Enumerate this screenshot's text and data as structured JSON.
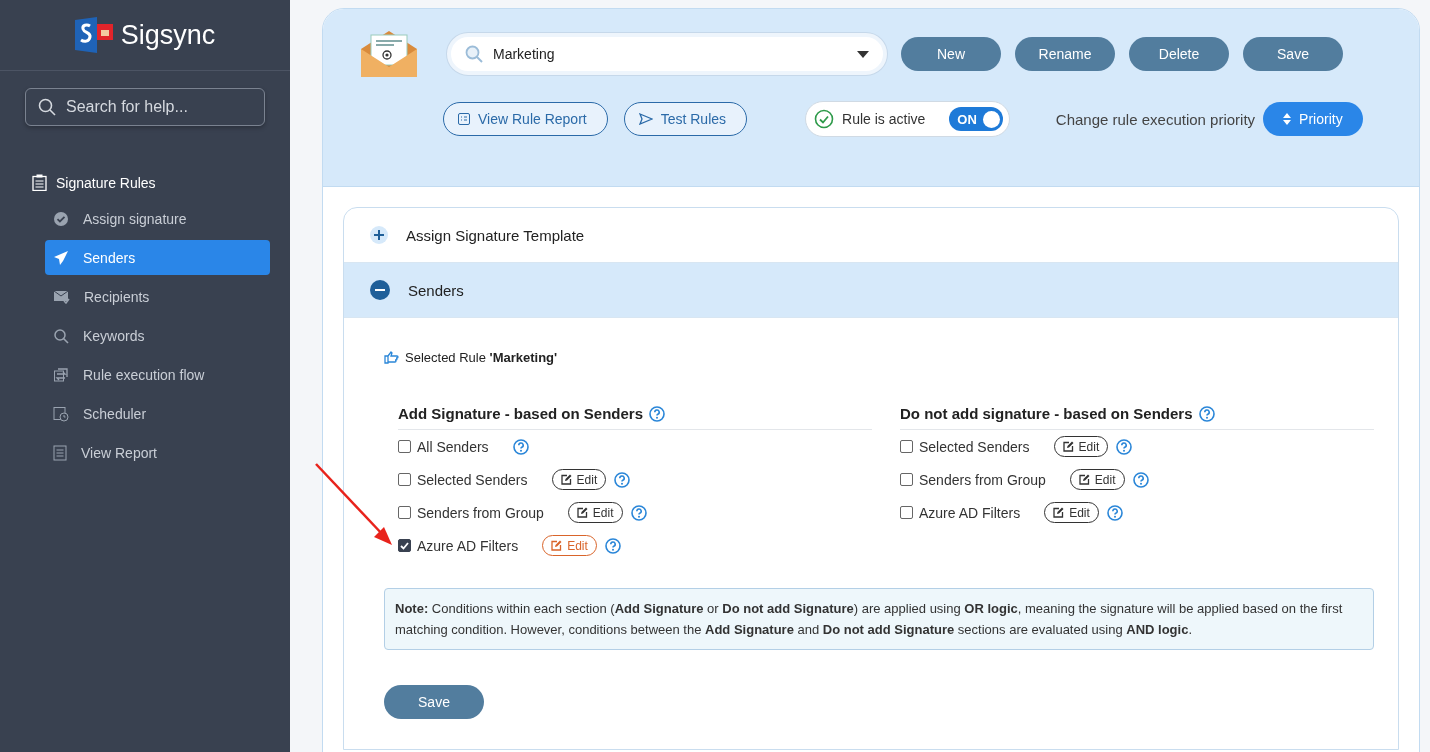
{
  "sidebar": {
    "logo": "Sigsync",
    "search": {
      "placeholder": "Search for help..."
    },
    "section": "Signature Rules",
    "items": [
      {
        "label": "Assign signature",
        "kind": "check",
        "selected": false
      },
      {
        "label": "Senders",
        "kind": "plane",
        "selected": true
      },
      {
        "label": "Recipients",
        "kind": "mail",
        "selected": false
      },
      {
        "label": "Keywords",
        "kind": "search",
        "selected": false
      },
      {
        "label": "Rule execution flow",
        "kind": "flow",
        "selected": false
      },
      {
        "label": "Scheduler",
        "kind": "calendar",
        "selected": false
      },
      {
        "label": "View Report",
        "kind": "report",
        "selected": false
      }
    ]
  },
  "toolbar": {
    "rule_select": {
      "value": "Marketing"
    },
    "buttons": [
      "New",
      "Rename",
      "Delete",
      "Save"
    ],
    "view_report": "View Rule Report",
    "test_rules": "Test Rules",
    "rule_active": {
      "label": "Rule is active",
      "toggle": "ON",
      "on": true
    },
    "priority_label": "Change rule execution priority",
    "priority_button": "Priority"
  },
  "accordion": [
    {
      "title": "Assign Signature Template",
      "expanded": false
    },
    {
      "title": "Senders",
      "expanded": true
    }
  ],
  "senders_panel": {
    "selected_rule": "Selected Rule **'Marketing'**",
    "sections": [
      {
        "title": "Add Signature - based on Senders",
        "options": [
          {
            "label": "All Senders",
            "checked": false
          },
          {
            "label": "Selected Senders",
            "checked": false,
            "edit": "Edit"
          },
          {
            "label": "Senders from Group",
            "checked": false,
            "edit": "Edit"
          },
          {
            "label": "Azure AD Filters",
            "checked": true,
            "edit": "Edit"
          }
        ]
      },
      {
        "title": "Do not add signature - based on Senders",
        "options": [
          {
            "label": "Selected Senders",
            "checked": false,
            "edit": "Edit"
          },
          {
            "label": "Senders from Group",
            "checked": false,
            "edit": "Edit"
          },
          {
            "label": "Azure AD Filters",
            "checked": false,
            "edit": "Edit"
          }
        ]
      }
    ],
    "note": "**Note:** Conditions within each section (**Add Signature** or **Do not add Signature**) are applied using **OR logic**, meaning the signature will be applied based on the first matching condition. However, conditions between the **Add Signature** and **Do not add Signature** sections are evaluated using **AND logic**.",
    "save_button": "Save"
  }
}
